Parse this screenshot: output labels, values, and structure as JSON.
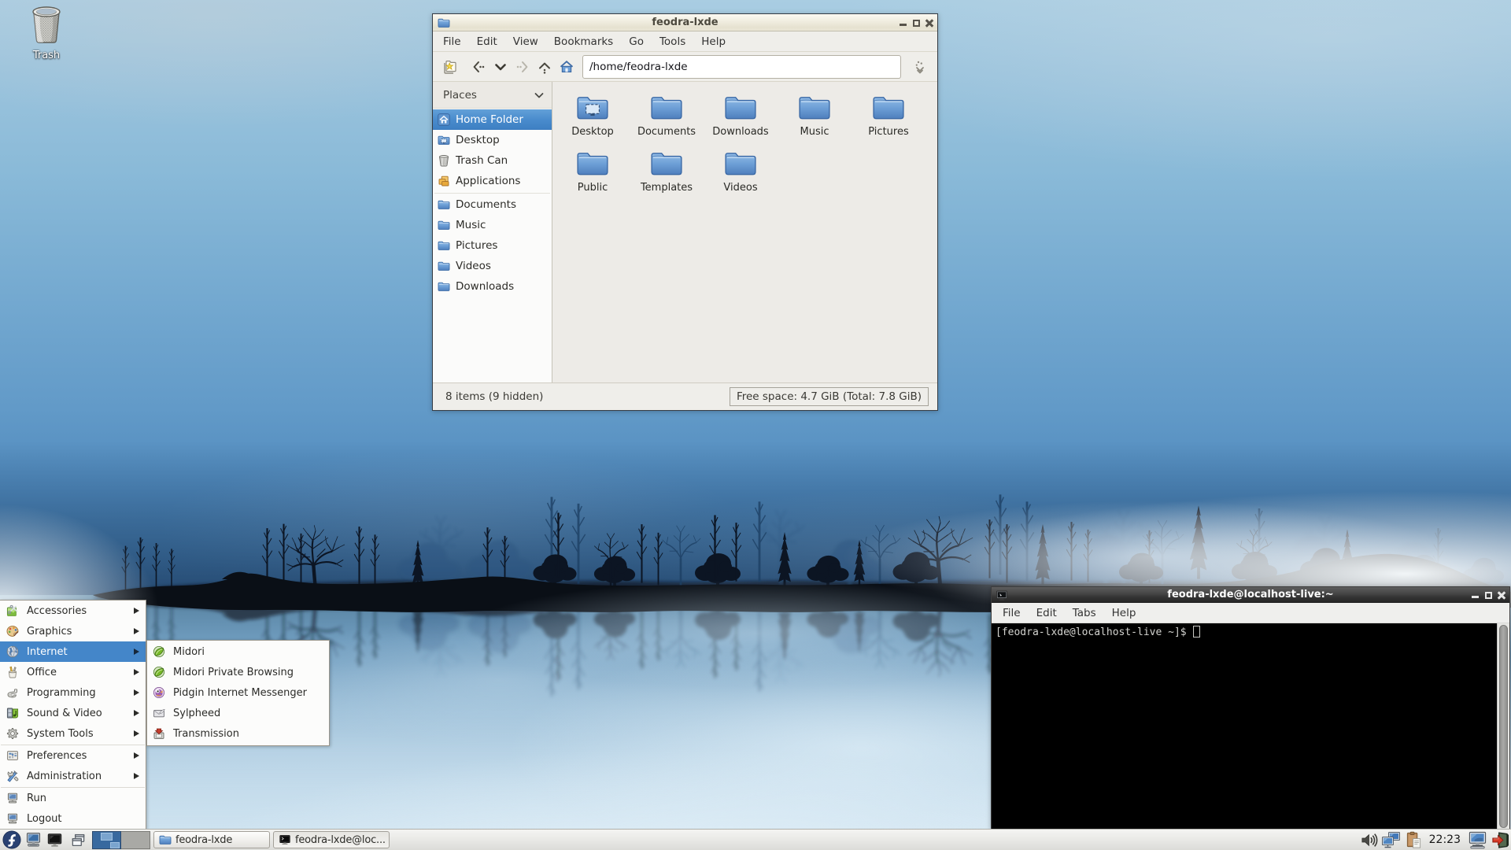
{
  "desktop": {
    "trash_label": "Trash"
  },
  "colors": {
    "selection_blue": "#4486c9",
    "titlebar_active_dark": "#323232",
    "titlebar_inactive_cream": "#ece8d9",
    "taskbar_bg": "#e9e9e6"
  },
  "file_manager": {
    "title": "feodra-lxde",
    "menu_items": [
      {
        "label": "File"
      },
      {
        "label": "Edit"
      },
      {
        "label": "View"
      },
      {
        "label": "Bookmarks"
      },
      {
        "label": "Go"
      },
      {
        "label": "Tools"
      },
      {
        "label": "Help"
      }
    ],
    "path_value": "/home/feodra-lxde",
    "places_header": "Places",
    "places": [
      {
        "label": "Home Folder",
        "icon": "home",
        "selected": true
      },
      {
        "label": "Desktop",
        "icon": "desktopfolder"
      },
      {
        "label": "Trash Can",
        "icon": "trashsmall"
      },
      {
        "label": "Applications",
        "icon": "apps"
      },
      {
        "separator": true
      },
      {
        "label": "Documents",
        "icon": "folder"
      },
      {
        "label": "Music",
        "icon": "folder"
      },
      {
        "label": "Pictures",
        "icon": "folder"
      },
      {
        "label": "Videos",
        "icon": "folder"
      },
      {
        "label": "Downloads",
        "icon": "folder"
      }
    ],
    "folders": [
      {
        "label": "Desktop",
        "icon": "bigdesktop"
      },
      {
        "label": "Documents",
        "icon": "bigfolder"
      },
      {
        "label": "Downloads",
        "icon": "bigfolder"
      },
      {
        "label": "Music",
        "icon": "bigfolder"
      },
      {
        "label": "Pictures",
        "icon": "bigfolder"
      },
      {
        "label": "Public",
        "icon": "bigfolder"
      },
      {
        "label": "Templates",
        "icon": "bigfolder"
      },
      {
        "label": "Videos",
        "icon": "bigfolder"
      }
    ],
    "status_left": "8 items (9 hidden)",
    "status_right": "Free space: 4.7 GiB (Total: 7.8 GiB)"
  },
  "terminal": {
    "title": "feodra-lxde@localhost-live:~",
    "menu_items": [
      {
        "label": "File"
      },
      {
        "label": "Edit"
      },
      {
        "label": "Tabs"
      },
      {
        "label": "Help"
      }
    ],
    "prompt": "[feodra-lxde@localhost-live ~]$"
  },
  "app_menu": {
    "items": [
      {
        "label": "Accessories",
        "icon": "accessories",
        "submenu": true
      },
      {
        "label": "Graphics",
        "icon": "graphics",
        "submenu": true
      },
      {
        "label": "Internet",
        "icon": "internet",
        "submenu": true,
        "highlight": true
      },
      {
        "label": "Office",
        "icon": "office",
        "submenu": true
      },
      {
        "label": "Programming",
        "icon": "programming",
        "submenu": true
      },
      {
        "label": "Sound & Video",
        "icon": "sound",
        "submenu": true
      },
      {
        "label": "System Tools",
        "icon": "systemtools",
        "submenu": true
      },
      {
        "separator": true
      },
      {
        "label": "Preferences",
        "icon": "preferences",
        "submenu": true
      },
      {
        "label": "Administration",
        "icon": "administration",
        "submenu": true
      },
      {
        "separator": true
      },
      {
        "label": "Run",
        "icon": "computer"
      },
      {
        "label": "Logout",
        "icon": "computer"
      }
    ],
    "submenu_items": [
      {
        "label": "Midori",
        "icon": "midori"
      },
      {
        "label": "Midori Private Browsing",
        "icon": "midori"
      },
      {
        "label": "Pidgin Internet Messenger",
        "icon": "pidgin"
      },
      {
        "label": "Sylpheed",
        "icon": "sylpheed"
      },
      {
        "label": "Transmission",
        "icon": "transmission"
      }
    ]
  },
  "taskbar": {
    "tasks": [
      {
        "label": "feodra-lxde",
        "icon": "folder"
      },
      {
        "label": "feodra-lxde@loc...",
        "icon": "terminal",
        "pressed": true
      }
    ],
    "clock": "22:23"
  }
}
